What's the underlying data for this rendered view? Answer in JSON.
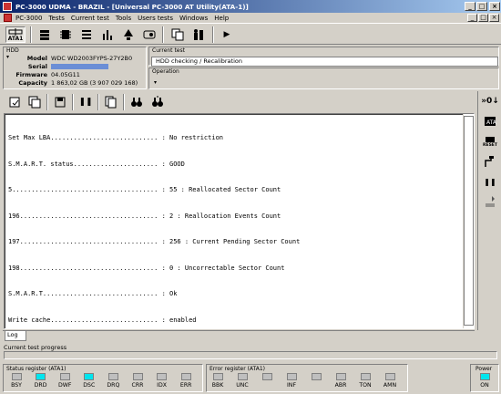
{
  "window": {
    "title": "PC-3000 UDMA - BRAZIL - [Universal PC-3000 AT Utility(ATA-1)]"
  },
  "menu": [
    "PC-3000",
    "Tests",
    "Current test",
    "Tools",
    "Users tests",
    "Windows",
    "Help"
  ],
  "toolbar": {
    "ata_label": "ATA1"
  },
  "hdd": {
    "section": "HDD",
    "model_label": "Model",
    "model": "WDC WD2003FYPS-27Y2B0",
    "serial_label": "Serial",
    "firmware_label": "Firmware",
    "firmware": "04.05G11",
    "capacity_label": "Capacity",
    "capacity": "1 863,02 GB (3 907 029 168)"
  },
  "current_test": {
    "label": "Current test",
    "value": "HDD checking / Recalibration"
  },
  "operation": {
    "label": "Operation"
  },
  "log": {
    "lines": [
      "Set Max LBA............................ : No restriction",
      "S.M.A.R.T. status...................... : GOOD",
      "5...................................... : 55 : Reallocated Sector Count",
      "196.................................... : 2 : Reallocation Events Count",
      "197.................................... : 256 : Current Pending Sector Count",
      "198.................................... : 0 : Uncorrectable Sector Count",
      "S.M.A.R.T.............................. : Ok",
      "Write cache............................ : enabled"
    ],
    "tab": "Log"
  },
  "side": {
    "ata": "ATA",
    "reset": "RESET"
  },
  "progress": {
    "label": "Current test progress"
  },
  "status_register": {
    "label": "Status register (ATA1)",
    "leds": [
      {
        "name": "BSY",
        "on": false
      },
      {
        "name": "DRD",
        "on": true
      },
      {
        "name": "DWF",
        "on": false
      },
      {
        "name": "DSC",
        "on": true
      },
      {
        "name": "DRQ",
        "on": false
      },
      {
        "name": "CRR",
        "on": false
      },
      {
        "name": "IDX",
        "on": false
      },
      {
        "name": "ERR",
        "on": false
      }
    ]
  },
  "error_register": {
    "label": "Error register (ATA1)",
    "leds": [
      {
        "name": "BBK",
        "on": false
      },
      {
        "name": "UNC",
        "on": false
      },
      {
        "name": "",
        "on": false
      },
      {
        "name": "INF",
        "on": false
      },
      {
        "name": "",
        "on": false
      },
      {
        "name": "ABR",
        "on": false
      },
      {
        "name": "TON",
        "on": false
      },
      {
        "name": "AMN",
        "on": false
      }
    ]
  },
  "power": {
    "label": "Power",
    "led": "ON",
    "on": true
  },
  "colors": {
    "led_on": "#00e5ee",
    "title_bar": "#0a246a",
    "serial_mask": "#6b8ed6"
  }
}
